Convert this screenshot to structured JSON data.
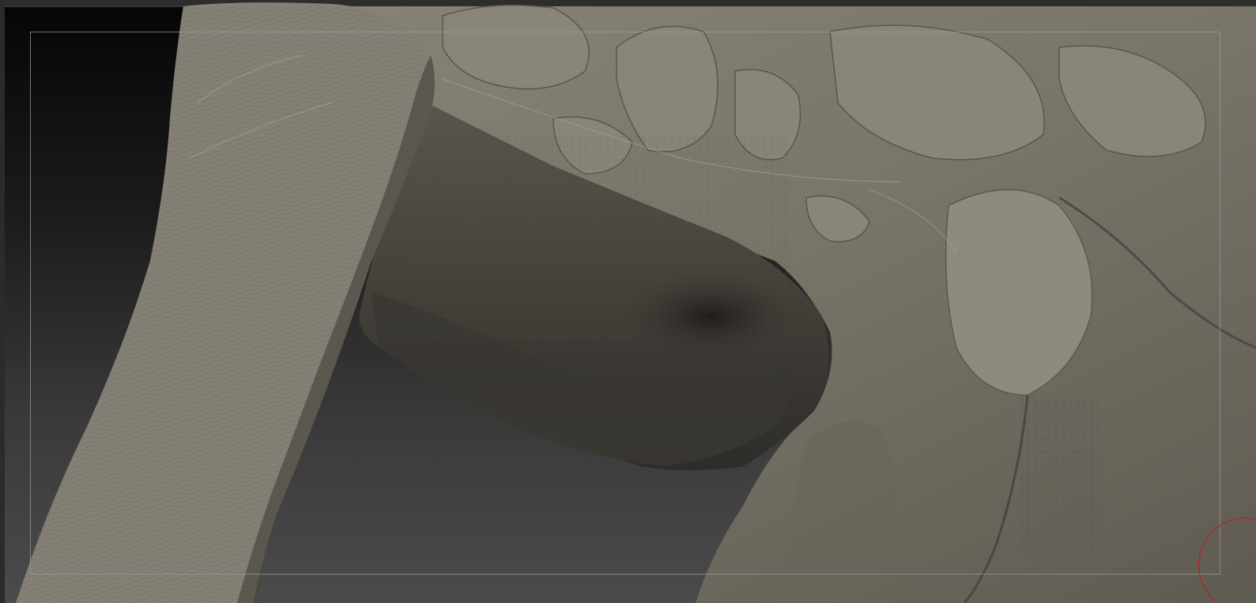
{
  "viewport": {
    "background_top": "#050505",
    "background_bottom": "#4b4b4b",
    "frame_guide_color": "#9a9a9a"
  },
  "model": {
    "material_base": "#7d786c",
    "material_light": "#a9a396",
    "material_shadow": "#2a2824"
  },
  "brush": {
    "cursor_color": "#c0191b",
    "icon": "brush-cursor-icon"
  }
}
